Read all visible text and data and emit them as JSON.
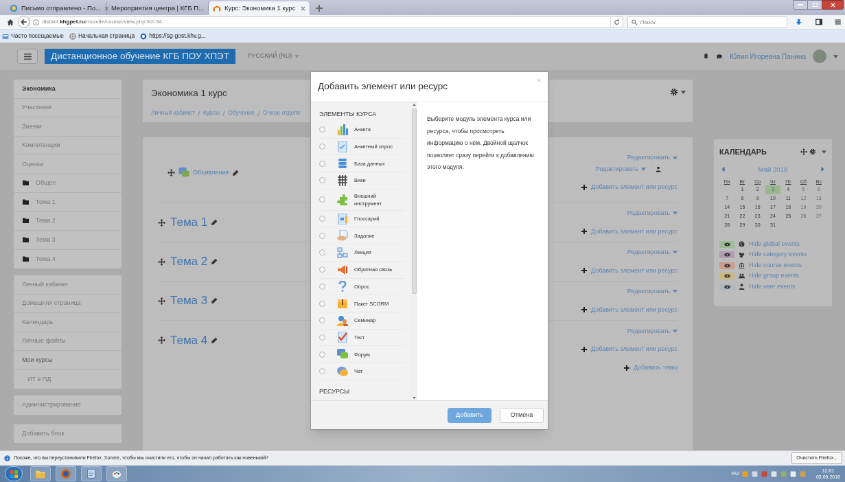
{
  "browser": {
    "tabs": [
      {
        "title": "Письмо отправлено - По...",
        "selected": false,
        "kind": "mail"
      },
      {
        "title": "Мероприятия центра | КГБ П...",
        "selected": false,
        "kind": "page"
      },
      {
        "title": "Курс: Экономика 1 курс",
        "selected": true,
        "kind": "moodle"
      }
    ],
    "url": "distant.**khgpet.ru**/moodle/course/view.php?id=34",
    "search": {
      "placeholder": "Поиск"
    },
    "bookmarks": [
      {
        "label": "Часто посещаемые",
        "kind": "star"
      },
      {
        "label": "Начальная страница",
        "kind": "globe"
      },
      {
        "label": "https://sg-gost.khv.g...",
        "kind": "site"
      }
    ]
  },
  "header": {
    "brand": "Дистанционное обучение КГБ ПОУ ХПЭТ",
    "language": "РУССКИЙ (RU)",
    "user_name": "Юлия Игоревна Панина"
  },
  "sidebar": {
    "blocks": [
      {
        "items": [
          {
            "label": "Экономика",
            "kind": "course"
          },
          {
            "label": "Участники",
            "kind": "link"
          },
          {
            "label": "Значки",
            "kind": "link"
          },
          {
            "label": "Компетенции",
            "kind": "link"
          },
          {
            "label": "Оценки",
            "kind": "link"
          },
          {
            "label": "Общее",
            "kind": "folder"
          },
          {
            "label": "Тема 1",
            "kind": "folder"
          },
          {
            "label": "Тема 2",
            "kind": "folder"
          },
          {
            "label": "Тема 3",
            "kind": "folder"
          },
          {
            "label": "Тема 4",
            "kind": "folder"
          }
        ]
      },
      {
        "items": [
          {
            "label": "Личный кабинет",
            "kind": "link"
          },
          {
            "label": "Домашняя страница",
            "kind": "link"
          },
          {
            "label": "Календарь",
            "kind": "link"
          },
          {
            "label": "Личные файлы",
            "kind": "link"
          },
          {
            "label": "Мои курсы",
            "kind": "current"
          },
          {
            "label": "ИТ в ПД",
            "kind": "child"
          }
        ]
      },
      {
        "items": [
          {
            "label": "Администрирование",
            "kind": "link"
          }
        ]
      },
      {
        "items": [
          {
            "label": "Добавить блок",
            "kind": "link"
          }
        ]
      }
    ]
  },
  "course": {
    "title": "Экономика 1 курс",
    "breadcrumb": [
      "Личный кабинет",
      "Курсы",
      "Обучение",
      "Очное отделе"
    ],
    "sections": [
      {
        "kind": "announcements",
        "title": "Объявления",
        "actions": [
          {
            "kind": "edit",
            "label": "Редактировать"
          },
          {
            "kind": "edit_user",
            "label": "Редактировать"
          },
          {
            "kind": "add",
            "label": "Добавить элемент или ресурс"
          }
        ]
      },
      {
        "kind": "topic",
        "title": "Тема 1",
        "actions": [
          {
            "kind": "edit",
            "label": "Редактировать"
          },
          {
            "kind": "add",
            "label": "Добавить элемент или ресурс"
          }
        ]
      },
      {
        "kind": "topic",
        "title": "Тема 2",
        "actions": [
          {
            "kind": "edit",
            "label": "Редактировать"
          },
          {
            "kind": "add",
            "label": "Добавить элемент или ресурс"
          }
        ]
      },
      {
        "kind": "topic",
        "title": "Тема 3",
        "actions": [
          {
            "kind": "edit",
            "label": "Редактировать"
          },
          {
            "kind": "add",
            "label": "Добавить элемент или ресурс"
          }
        ]
      },
      {
        "kind": "topic",
        "title": "Тема 4",
        "actions": [
          {
            "kind": "edit",
            "label": "Редактировать"
          },
          {
            "kind": "add",
            "label": "Добавить элемент или ресурс"
          }
        ]
      }
    ],
    "add_sections": "Добавить темы"
  },
  "calendar": {
    "title": "КАЛЕНДАРЬ",
    "month": "Май 2018",
    "weekdays": [
      "Пн",
      "Вт",
      "Ср",
      "Чт",
      "Пт",
      "Сб",
      "Вс"
    ],
    "weeks": [
      [
        {
          "label": "1",
          "today": false
        },
        {
          "label": "2",
          "today": false
        },
        {
          "label": "3",
          "today": true
        },
        {
          "label": "4",
          "today": false
        },
        {
          "label": "5",
          "today": false
        },
        {
          "label": "6",
          "today": false
        }
      ],
      [
        {
          "label": "7",
          "today": false
        },
        {
          "label": "8",
          "today": false
        },
        {
          "label": "9",
          "today": false
        },
        {
          "label": "10",
          "today": false
        },
        {
          "label": "11",
          "today": false
        },
        {
          "label": "12",
          "today": false
        },
        {
          "label": "13",
          "today": false
        }
      ],
      [
        {
          "label": "14",
          "today": false
        },
        {
          "label": "15",
          "today": false
        },
        {
          "label": "16",
          "today": false
        },
        {
          "label": "17",
          "today": false
        },
        {
          "label": "18",
          "today": false
        },
        {
          "label": "19",
          "today": false
        },
        {
          "label": "20",
          "today": false
        }
      ],
      [
        {
          "label": "21",
          "today": false
        },
        {
          "label": "22",
          "today": false
        },
        {
          "label": "23",
          "today": false
        },
        {
          "label": "24",
          "today": false
        },
        {
          "label": "25",
          "today": false
        },
        {
          "label": "26",
          "today": false
        },
        {
          "label": "27",
          "today": false
        }
      ],
      [
        {
          "label": "28",
          "today": false
        },
        {
          "label": "29",
          "today": false
        },
        {
          "label": "30",
          "today": false
        },
        {
          "label": "31",
          "today": false
        }
      ]
    ],
    "events": [
      {
        "label": "Hide global events",
        "kind": "global",
        "color": "#9fbb98"
      },
      {
        "label": "Hide category events",
        "kind": "category",
        "color": "#b39bb0"
      },
      {
        "label": "Hide course events",
        "kind": "course",
        "color": "#cc9d8c"
      },
      {
        "label": "Hide group events",
        "kind": "group",
        "color": "#cbb87f"
      },
      {
        "label": "Hide user events",
        "kind": "user",
        "color": "#b1b6bd"
      }
    ]
  },
  "modal": {
    "title": "Добавить элемент или ресурс",
    "close": "×",
    "group_heading": "ЭЛЕМЕНТЫ КУРСА",
    "modules": [
      {
        "label": "Анкета",
        "kind": "chart",
        "selected": false
      },
      {
        "label": "Анкетный опрос",
        "kind": "checklist",
        "selected": false
      },
      {
        "label": "База данных",
        "kind": "database",
        "selected": false
      },
      {
        "label": "Вики",
        "kind": "wiki",
        "selected": false
      },
      {
        "label": "Внешний инструмент",
        "kind": "puzzle",
        "selected": false
      },
      {
        "label": "Глоссарий",
        "kind": "glossary",
        "selected": false
      },
      {
        "label": "Задание",
        "kind": "assignment",
        "selected": false
      },
      {
        "label": "Лекция",
        "kind": "lesson",
        "selected": false
      },
      {
        "label": "Обратная связь",
        "kind": "megaphone",
        "selected": false
      },
      {
        "label": "Опрос",
        "kind": "question",
        "selected": false
      },
      {
        "label": "Пакет SCORM",
        "kind": "box",
        "selected": false
      },
      {
        "label": "Семинар",
        "kind": "people",
        "selected": false
      },
      {
        "label": "Тест",
        "kind": "quiz",
        "selected": false
      },
      {
        "label": "Форум",
        "kind": "forum",
        "selected": false
      },
      {
        "label": "Чат",
        "kind": "chat",
        "selected": false
      }
    ],
    "resources_heading": "РЕСУРСЫ",
    "description": "Выберите модуль элемента курса или ресурса, чтобы просмотреть информацию о нём. Двойной щелчок позволяет сразу перейти к добавлению этого модуля.",
    "buttons": [
      {
        "label": "Добавить",
        "kind": "primary"
      },
      {
        "label": "Отмена",
        "kind": "secondary"
      }
    ]
  },
  "notification": {
    "text": "Похоже, что вы переустановили Firefox. Хотите, чтобы мы очистили его, чтобы он начал работать как новенький?",
    "button": "Очистить Firefox..."
  },
  "taskbar": {
    "apps": [
      {
        "kind": "explorer"
      },
      {
        "kind": "firefox"
      },
      {
        "kind": "notepad"
      },
      {
        "kind": "paint"
      }
    ],
    "language": "RU",
    "time": "12:01",
    "date": "03.05.2018"
  }
}
